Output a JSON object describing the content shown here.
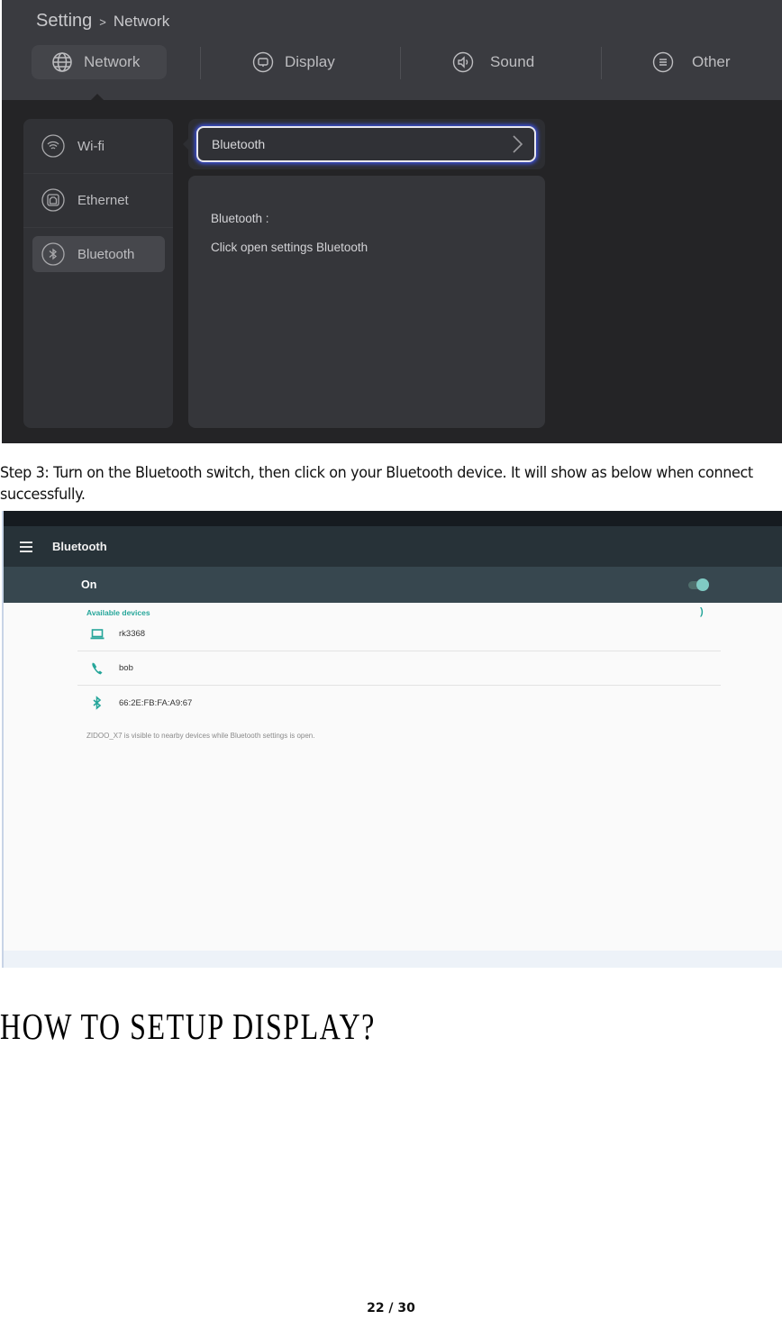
{
  "tv_settings": {
    "breadcrumb": {
      "root": "Setting",
      "separator": ">",
      "current": "Network"
    },
    "tabs": [
      {
        "label": "Network",
        "icon": "globe-icon",
        "active": true
      },
      {
        "label": "Display",
        "icon": "display-icon",
        "active": false
      },
      {
        "label": "Sound",
        "icon": "speaker-icon",
        "active": false
      },
      {
        "label": "Other",
        "icon": "menu-lines-icon",
        "active": false
      }
    ],
    "sidebar": [
      {
        "label": "Wi-fi",
        "icon": "wifi-icon",
        "active": false
      },
      {
        "label": "Ethernet",
        "icon": "ethernet-icon",
        "active": false
      },
      {
        "label": "Bluetooth",
        "icon": "bluetooth-icon",
        "active": true
      }
    ],
    "selected_option": {
      "label": "Bluetooth",
      "icon": "chevron-right-icon"
    },
    "panel": {
      "title": "Bluetooth :",
      "description": "Click open settings Bluetooth"
    }
  },
  "step_text": "Step 3: Turn on the Bluetooth switch, then click on your Bluetooth device. It will show as below when connect successfully.",
  "bt_settings": {
    "title": "Bluetooth",
    "menu_icon": "hamburger-icon",
    "switch_label": "On",
    "switch_on": true,
    "section_label": "Available devices",
    "devices": [
      {
        "name": "rk3368",
        "icon": "laptop-icon"
      },
      {
        "name": "bob",
        "icon": "phone-icon"
      },
      {
        "name": "66:2E:FB:FA:A9:67",
        "icon": "bluetooth-icon"
      }
    ],
    "visibility_note": "ZIDOO_X7 is visible to nearby devices while Bluetooth settings is open.",
    "colors": {
      "accent": "#26a69a",
      "toolbar": "#273238",
      "switchbar": "#37474f"
    }
  },
  "heading": "HOW TO SETUP DISPLAY?",
  "page_number": "22 / 30"
}
